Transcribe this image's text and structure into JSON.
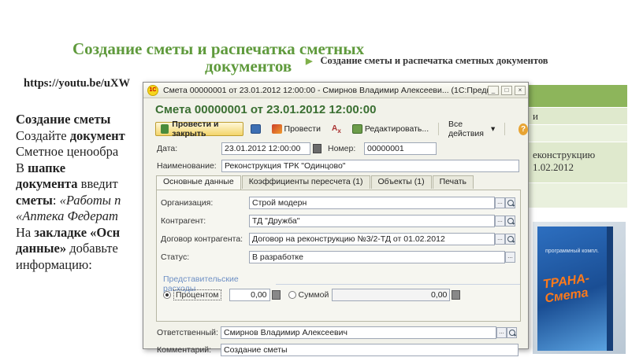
{
  "slide": {
    "title_line1": "Создание сметы и распечатка сметных",
    "title_line2": "документов",
    "bullet": "Создание сметы и распечатка сметных документов",
    "url": "https://youtu.be/uXW",
    "body": {
      "l1": "Создание сметы",
      "l2a": "Создайте ",
      "l2b": "документ",
      "l3": "Сметное ценообра",
      "l4a": "В ",
      "l4b": "шапке",
      "l5a": "документа",
      "l5b": " введит",
      "l6a": "сметы",
      "l6b": ": ",
      "l6c": "«Работы п",
      "l7": "«Аптека Федерат",
      "l8a": "На ",
      "l8b": "закладке «Осн",
      "l9a": "данные»",
      "l9b": " добавьте",
      "l10": "информацию:"
    },
    "table_text": {
      "r1": "и",
      "r3a": "еконструкцию",
      "r3b": "1.02.2012"
    },
    "box": {
      "tag": "программный компл.",
      "logo": "ТРАНА-Смета"
    }
  },
  "window": {
    "title": "Смета 00000001 от 23.01.2012 12:00:00 - Смирнов Владимир Алексееви... (1С:Предприятие)",
    "logo_text": "1С",
    "min": "_",
    "max": "□",
    "close": "×",
    "doc_title": "Смета 00000001 от 23.01.2012 12:00:00",
    "toolbar": {
      "post_close": "Провести и закрыть",
      "post": "Провести",
      "edit": "Редактировать...",
      "all_actions": "Все действия",
      "all_actions_arrow": "▾",
      "help": "?"
    },
    "header": {
      "date_label": "Дата:",
      "date_value": "23.01.2012 12:00:00",
      "number_label": "Номер:",
      "number_value": "00000001",
      "name_label": "Наименование:",
      "name_value": "Реконструкция ТРК \"Одинцово\""
    },
    "tabs": [
      "Основные данные",
      "Коэффициенты пересчета (1)",
      "Объекты (1)",
      "Печать"
    ],
    "main": {
      "org_label": "Организация:",
      "org_value": "Строй модерн",
      "contractor_label": "Контрагент:",
      "contractor_value": "ТД \"Дружба\"",
      "contract_label": "Договор контрагента:",
      "contract_value": "Договор на реконструкцию №3/2-ТД от 01.02.2012",
      "status_label": "Статус:",
      "status_value": "В разработке",
      "repr_header": "Представительские расходы",
      "percent_label": "Процентом",
      "percent_value": "0,00",
      "sum_label": "Суммой",
      "sum_value": "0,00"
    },
    "footer": {
      "responsible_label": "Ответственный:",
      "responsible_value": "Смирнов Владимир Алексеевич",
      "comment_label": "Комментарий:",
      "comment_value": "Создание сметы"
    },
    "pick_glyph": "...",
    "colors": {
      "title_green": "#3a6f32",
      "slide_green": "#5f9a3c",
      "primary_btn": "#f3d56a",
      "group_blue": "#6d8fc4"
    }
  }
}
